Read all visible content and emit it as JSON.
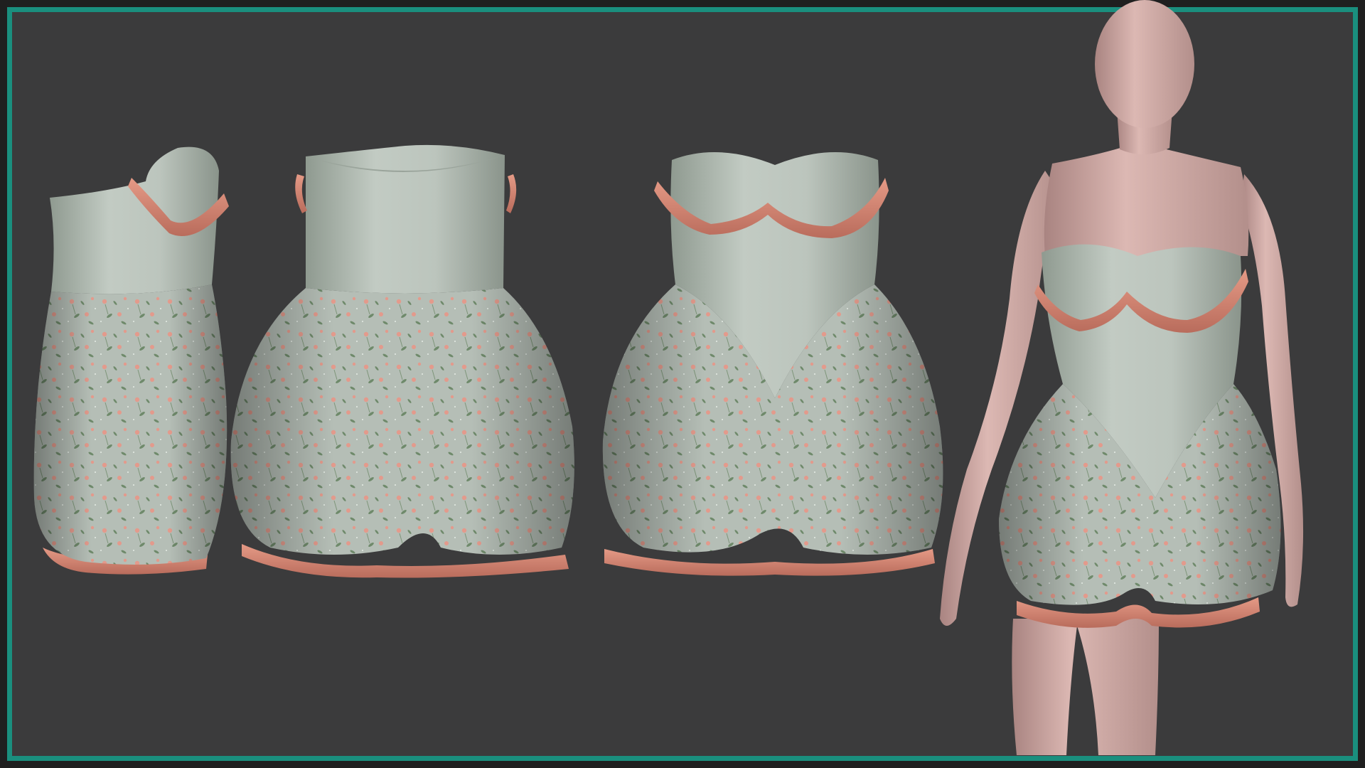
{
  "scene": {
    "background_color": "#3b3b3c",
    "border_color": "#1a8f7e",
    "fabric_bodice_color": "#b9c2ba",
    "fabric_print_base_color": "#b5beb6",
    "ruffle_color": "#d98a78",
    "print_flower_color": "#e39a8c",
    "print_leaf_color": "#6f8a6b",
    "mannequin_skin_color": "#d8b3ae",
    "views": [
      {
        "view": "side-view"
      },
      {
        "view": "back-view"
      },
      {
        "view": "front-view"
      },
      {
        "view": "on-mannequin"
      }
    ]
  }
}
